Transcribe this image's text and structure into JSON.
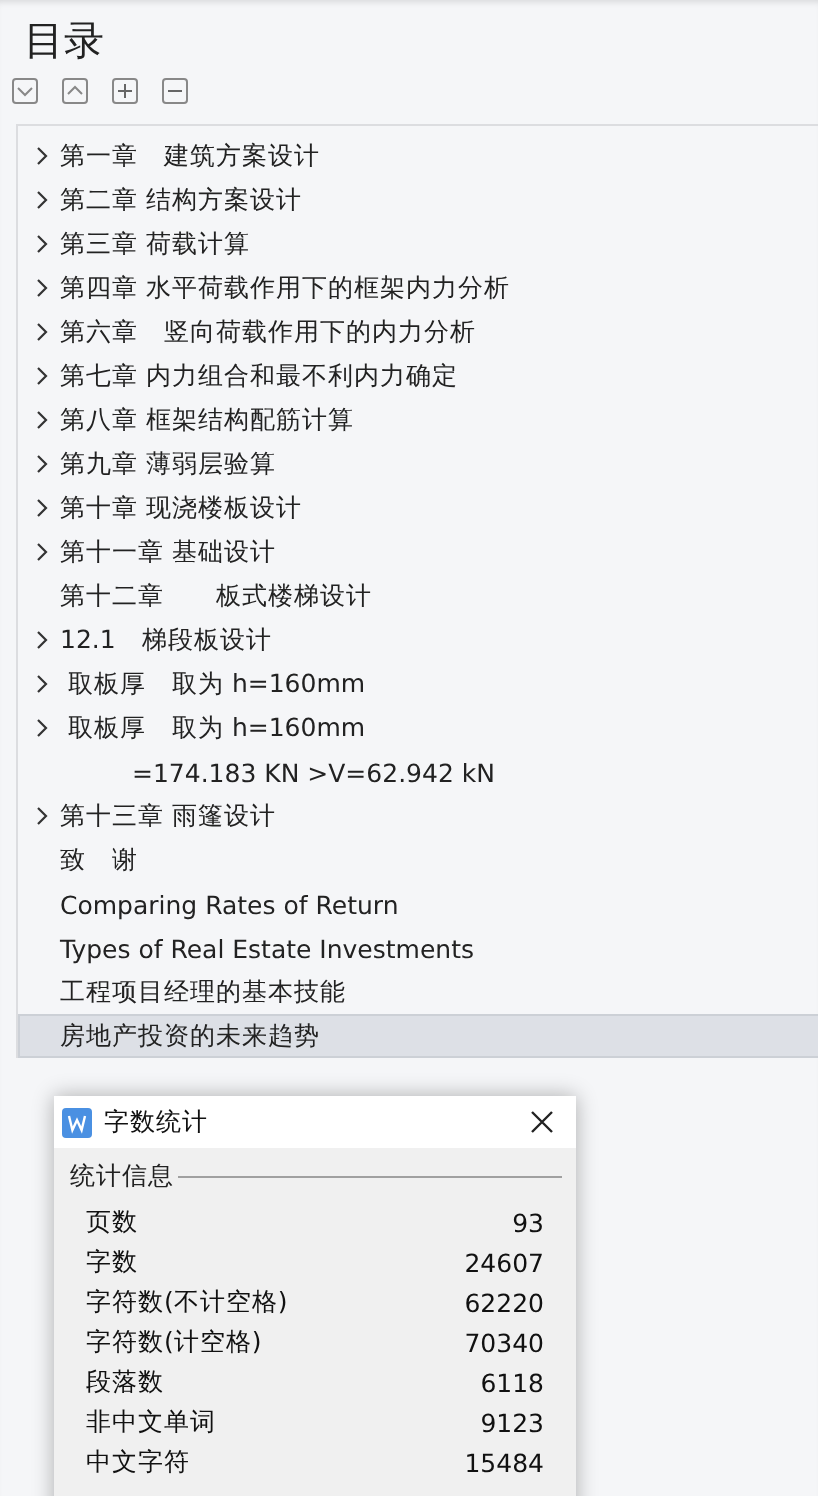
{
  "title": "目录",
  "toolbar": [
    {
      "kind": "collapse"
    },
    {
      "kind": "expand"
    },
    {
      "kind": "plus"
    },
    {
      "kind": "minus"
    }
  ],
  "toc": [
    {
      "label": "第一章　建筑方案设计",
      "kind": "branch",
      "selected": false
    },
    {
      "label": "第二章 结构方案设计",
      "kind": "branch",
      "selected": false
    },
    {
      "label": "第三章 荷载计算",
      "kind": "branch",
      "selected": false
    },
    {
      "label": "第四章 水平荷载作用下的框架内力分析",
      "kind": "branch",
      "selected": false
    },
    {
      "label": "第六章　竖向荷载作用下的内力分析",
      "kind": "branch",
      "selected": false
    },
    {
      "label": "第七章 内力组合和最不利内力确定",
      "kind": "branch",
      "selected": false
    },
    {
      "label": "第八章 框架结构配筋计算",
      "kind": "branch",
      "selected": false
    },
    {
      "label": "第九章 薄弱层验算",
      "kind": "branch",
      "selected": false
    },
    {
      "label": "第十章 现浇楼板设计",
      "kind": "branch",
      "selected": false
    },
    {
      "label": "第十一章 基础设计",
      "kind": "branch",
      "selected": false
    },
    {
      "label": "第十二章　　板式楼梯设计",
      "kind": "leaf",
      "selected": false
    },
    {
      "label": "12.1　梯段板设计",
      "kind": "branch",
      "selected": false
    },
    {
      "label": " 取板厚　取为 h=160mm",
      "kind": "branch",
      "selected": false
    },
    {
      "label": " 取板厚　取为 h=160mm",
      "kind": "branch",
      "selected": false
    },
    {
      "label": "=174.183 KN >V=62.942 kN",
      "kind": "deep",
      "selected": false
    },
    {
      "label": "第十三章 雨篷设计",
      "kind": "branch",
      "selected": false
    },
    {
      "label": "致　谢",
      "kind": "leaf",
      "selected": false
    },
    {
      "label": "Comparing Rates of Return",
      "kind": "leaf",
      "selected": false
    },
    {
      "label": "Types of Real Estate Investments",
      "kind": "leaf",
      "selected": false
    },
    {
      "label": "工程项目经理的基本技能",
      "kind": "leaf",
      "selected": false
    },
    {
      "label": "房地产投资的未来趋势",
      "kind": "leaf",
      "selected": true
    }
  ],
  "dialog": {
    "title": "字数统计",
    "group": "统计信息",
    "stats": [
      {
        "label": "页数",
        "value": "93"
      },
      {
        "label": "字数",
        "value": "24607"
      },
      {
        "label": "字符数(不计空格)",
        "value": "62220"
      },
      {
        "label": "字符数(计空格)",
        "value": "70340"
      },
      {
        "label": "段落数",
        "value": "6118"
      },
      {
        "label": "非中文单词",
        "value": "9123"
      },
      {
        "label": "中文字符",
        "value": "15484"
      }
    ]
  }
}
